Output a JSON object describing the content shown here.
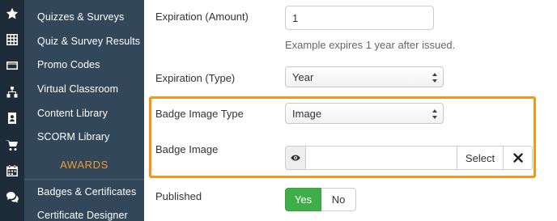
{
  "rail": {
    "icons": [
      "star-icon",
      "grid-icon",
      "credit-card-icon",
      "sitemap-icon",
      "id-badge-icon",
      "cart-icon",
      "calendar-icon",
      "comments-icon"
    ]
  },
  "sidebar": {
    "items": [
      {
        "label": "Quizzes & Surveys"
      },
      {
        "label": "Quiz & Survey Results"
      },
      {
        "label": "Promo Codes"
      },
      {
        "label": "Virtual Classroom"
      },
      {
        "label": "Content Library"
      },
      {
        "label": "SCORM Library"
      }
    ],
    "section_title": "AWARDS",
    "award_items": [
      {
        "label": "Badges & Certificates"
      },
      {
        "label": "Certificate Designer"
      }
    ]
  },
  "form": {
    "expiration_amount": {
      "label": "Expiration (Amount)",
      "value": "1",
      "help": "Example expires 1 year after issued."
    },
    "expiration_type": {
      "label": "Expiration (Type)",
      "value": "Year"
    },
    "badge_image_type": {
      "label": "Badge Image Type",
      "value": "Image"
    },
    "badge_image": {
      "label": "Badge Image",
      "select_label": "Select"
    },
    "published": {
      "label": "Published",
      "yes_label": "Yes",
      "no_label": "No",
      "selected": "Yes"
    }
  },
  "colors": {
    "rail_bg": "#1e2b38",
    "sidebar_bg": "#33475b",
    "section_accent": "#f19a2c",
    "highlight_border": "#f7941d",
    "yes_active": "#3fae49"
  }
}
